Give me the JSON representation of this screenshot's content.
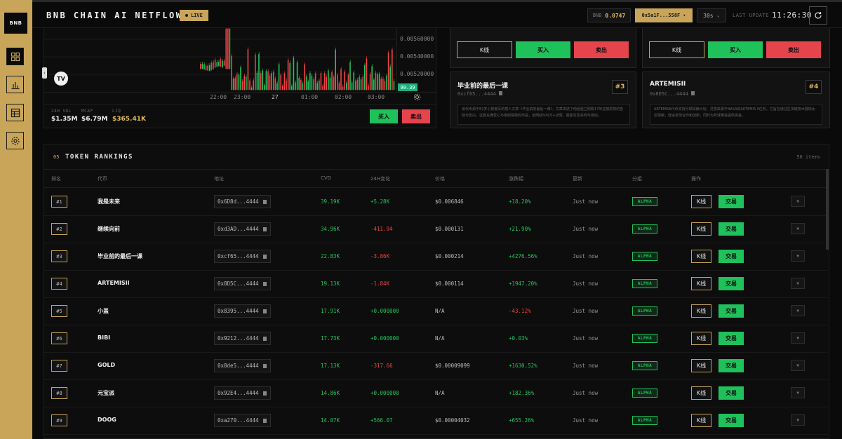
{
  "sidebar": {
    "logo": "BNB",
    "items": [
      {
        "icon": "grid-icon"
      },
      {
        "icon": "bar-chart-icon"
      },
      {
        "icon": "table-icon"
      },
      {
        "icon": "gear-icon"
      }
    ]
  },
  "header": {
    "title": "BNB CHAIN AI NETFLOW",
    "live_label": "LIVE",
    "price_label": "BNB",
    "price_value": "0.0747",
    "wallet": "0x5a1F...558F",
    "interval": "30s",
    "last_update_label": "LAST UPDATE",
    "last_update_time": "11:26:30"
  },
  "chart": {
    "y_ticks": [
      "0.00560000",
      "0.00540000",
      "0.00520000"
    ],
    "x_ticks": [
      "22:00",
      "23:00",
      "27",
      "01:00",
      "02:00",
      "03:00"
    ],
    "last_price_tag": "99.39",
    "tv_logo": "TV",
    "stats": [
      {
        "label": "24H VOL",
        "value": "$1.35M"
      },
      {
        "label": "MCAP",
        "value": "$6.79M"
      },
      {
        "label": "LIQ",
        "value": "$365.41K"
      }
    ],
    "buy_label": "买入",
    "sell_label": "卖出"
  },
  "card_actions": {
    "k_label": "K线",
    "buy_label": "买入",
    "sell_label": "卖出"
  },
  "cards": [
    {
      "name": "毕业前的最后一课",
      "addr": "0xcf65...4444",
      "rank": "#3",
      "desc": "该代币源于82岁小狗摄写的感人文章《毕业前的最后一课》，文章讲述了他经验立刚刚17年迎接爱狗的告别与告白，这篇充满爱心与离别情感的作品，全网获500万+点赞，最能引发共鸣与感动。"
    },
    {
      "name": "ARTEMISII",
      "addr": "0x8D5C...4444",
      "rank": "#4",
      "desc": "ARTEMISII代币支持月球探索计划，灵感来源于NASA的ARTEMIS II任务。它旨在通过区块链技术展现太空探索，促进全球合作和创新，同时为月球推进提供资金。"
    }
  ],
  "rankings": {
    "section_num": "05",
    "title": "TOKEN RANKINGS",
    "count": "50 items",
    "columns": [
      "排名",
      "代币",
      "地址",
      "CVD",
      "24H变化",
      "价格",
      "涨跌幅",
      "更新",
      "分组",
      "操作"
    ],
    "k_label": "K线",
    "trade_label": "交易",
    "rows": [
      {
        "rank": "#1",
        "name": "我是未来",
        "addr": "0x6D8d...4444",
        "cvd": "39.19K",
        "chg": "+5.28K",
        "chg_dir": "up",
        "price": "$0.006846",
        "pct": "+18.20%",
        "pct_dir": "up",
        "updated": "Just now",
        "group": "ALPHA"
      },
      {
        "rank": "#2",
        "name": "继续向前",
        "addr": "0xd3AD...4444",
        "cvd": "34.96K",
        "chg": "-411.94",
        "chg_dir": "down",
        "price": "$0.000131",
        "pct": "+21.90%",
        "pct_dir": "up",
        "updated": "Just now",
        "group": "ALPHA"
      },
      {
        "rank": "#3",
        "name": "毕业前的最后一课",
        "addr": "0xcf65...4444",
        "cvd": "22.83K",
        "chg": "-3.86K",
        "chg_dir": "down",
        "price": "$0.000214",
        "pct": "+4276.56%",
        "pct_dir": "up",
        "updated": "Just now",
        "group": "ALPHA"
      },
      {
        "rank": "#4",
        "name": "ARTEMISII",
        "addr": "0x8D5C...4444",
        "cvd": "19.13K",
        "chg": "-1.84K",
        "chg_dir": "down",
        "price": "$0.000114",
        "pct": "+1947.20%",
        "pct_dir": "up",
        "updated": "Just now",
        "group": "ALPHA"
      },
      {
        "rank": "#5",
        "name": "小盖",
        "addr": "0x8395...4444",
        "cvd": "17.91K",
        "chg": "+0.000000",
        "chg_dir": "up",
        "price": "N/A",
        "pct": "-43.12%",
        "pct_dir": "down",
        "updated": "Just now",
        "group": "ALPHA"
      },
      {
        "rank": "#6",
        "name": "BIBI",
        "addr": "0x9212...4444",
        "cvd": "17.73K",
        "chg": "+0.000000",
        "chg_dir": "up",
        "price": "N/A",
        "pct": "+0.03%",
        "pct_dir": "up",
        "updated": "Just now",
        "group": "ALPHA"
      },
      {
        "rank": "#7",
        "name": "GOLD",
        "addr": "0x8de5...4444",
        "cvd": "17.13K",
        "chg": "-317.66",
        "chg_dir": "down",
        "price": "$0.00009099",
        "pct": "+1630.52%",
        "pct_dir": "up",
        "updated": "Just now",
        "group": "ALPHA"
      },
      {
        "rank": "#8",
        "name": "元宝派",
        "addr": "0x92E4...4444",
        "cvd": "14.86K",
        "chg": "+0.000000",
        "chg_dir": "up",
        "price": "N/A",
        "pct": "+182.36%",
        "pct_dir": "up",
        "updated": "Just now",
        "group": "ALPHA"
      },
      {
        "rank": "#9",
        "name": "DOOG",
        "addr": "0xa270...4444",
        "cvd": "14.07K",
        "chg": "+566.07",
        "chg_dir": "up",
        "price": "$0.00004032",
        "pct": "+655.26%",
        "pct_dir": "up",
        "updated": "Just now",
        "group": "ALPHA"
      }
    ]
  },
  "colors": {
    "gold": "#c9a55a",
    "green": "#1fc15b",
    "red": "#e6444c",
    "bg": "#0a0a0a"
  }
}
